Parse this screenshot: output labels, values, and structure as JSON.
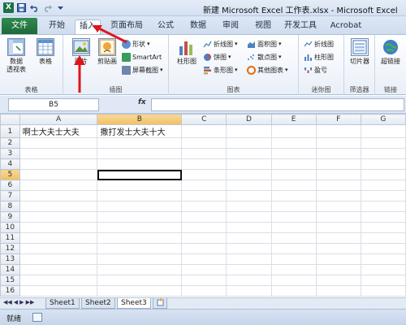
{
  "window": {
    "title": "新建 Microsoft Excel 工作表.xlsx - Microsoft Excel"
  },
  "quick_access": {
    "logo": "X",
    "save_icon": "save-icon",
    "undo_icon": "undo-icon",
    "redo_icon": "redo-icon",
    "customize_icon": "customize-icon"
  },
  "tabs": [
    {
      "label": "文件"
    },
    {
      "label": "开始"
    },
    {
      "label": "插入"
    },
    {
      "label": "页面布局"
    },
    {
      "label": "公式"
    },
    {
      "label": "数据"
    },
    {
      "label": "审阅"
    },
    {
      "label": "视图"
    },
    {
      "label": "开发工具"
    },
    {
      "label": "Acrobat"
    }
  ],
  "active_tab": "插入",
  "ribbon": {
    "groups": {
      "tables": {
        "label": "表格",
        "pivot": "数据\n透视表",
        "table": "表格"
      },
      "illustrations": {
        "label": "插图",
        "picture": "图片",
        "clipart": "剪贴画",
        "shapes": "形状",
        "smartart": "SmartArt",
        "screenshot": "屏幕截图"
      },
      "charts": {
        "label": "图表",
        "column": "柱形图",
        "line": "折线图",
        "pie": "饼图",
        "bar": "条形图",
        "area": "面积图",
        "scatter": "散点图",
        "other": "其他图表"
      },
      "sparklines": {
        "label": "迷你图",
        "line": "折线图",
        "column": "柱形图",
        "winloss": "盈亏"
      },
      "filter": {
        "label": "筛选器",
        "slicer": "切片器"
      },
      "links": {
        "label": "链接",
        "hyperlink": "超链接"
      }
    }
  },
  "formula_bar": {
    "name_box": "B5",
    "fx": "fx",
    "value": ""
  },
  "sheet": {
    "columns": [
      "A",
      "B",
      "C",
      "D",
      "E",
      "F",
      "G"
    ],
    "rows": [
      "1",
      "2",
      "3",
      "4",
      "5",
      "6",
      "7",
      "8",
      "9",
      "10",
      "11",
      "12",
      "13",
      "14",
      "15",
      "16"
    ],
    "cells": {
      "A1": "啊士大夫士大夫",
      "B1": "撒打发士大夫十大"
    },
    "selected_cell": "B5"
  },
  "sheet_tabs": [
    "Sheet1",
    "Sheet2",
    "Sheet3"
  ],
  "active_sheet": "Sheet3",
  "status": {
    "text": "就绪"
  },
  "colors": {
    "file_tab": "#1e6a3a",
    "annotation": "#e0141c",
    "selection_header": "#f1c15f"
  }
}
